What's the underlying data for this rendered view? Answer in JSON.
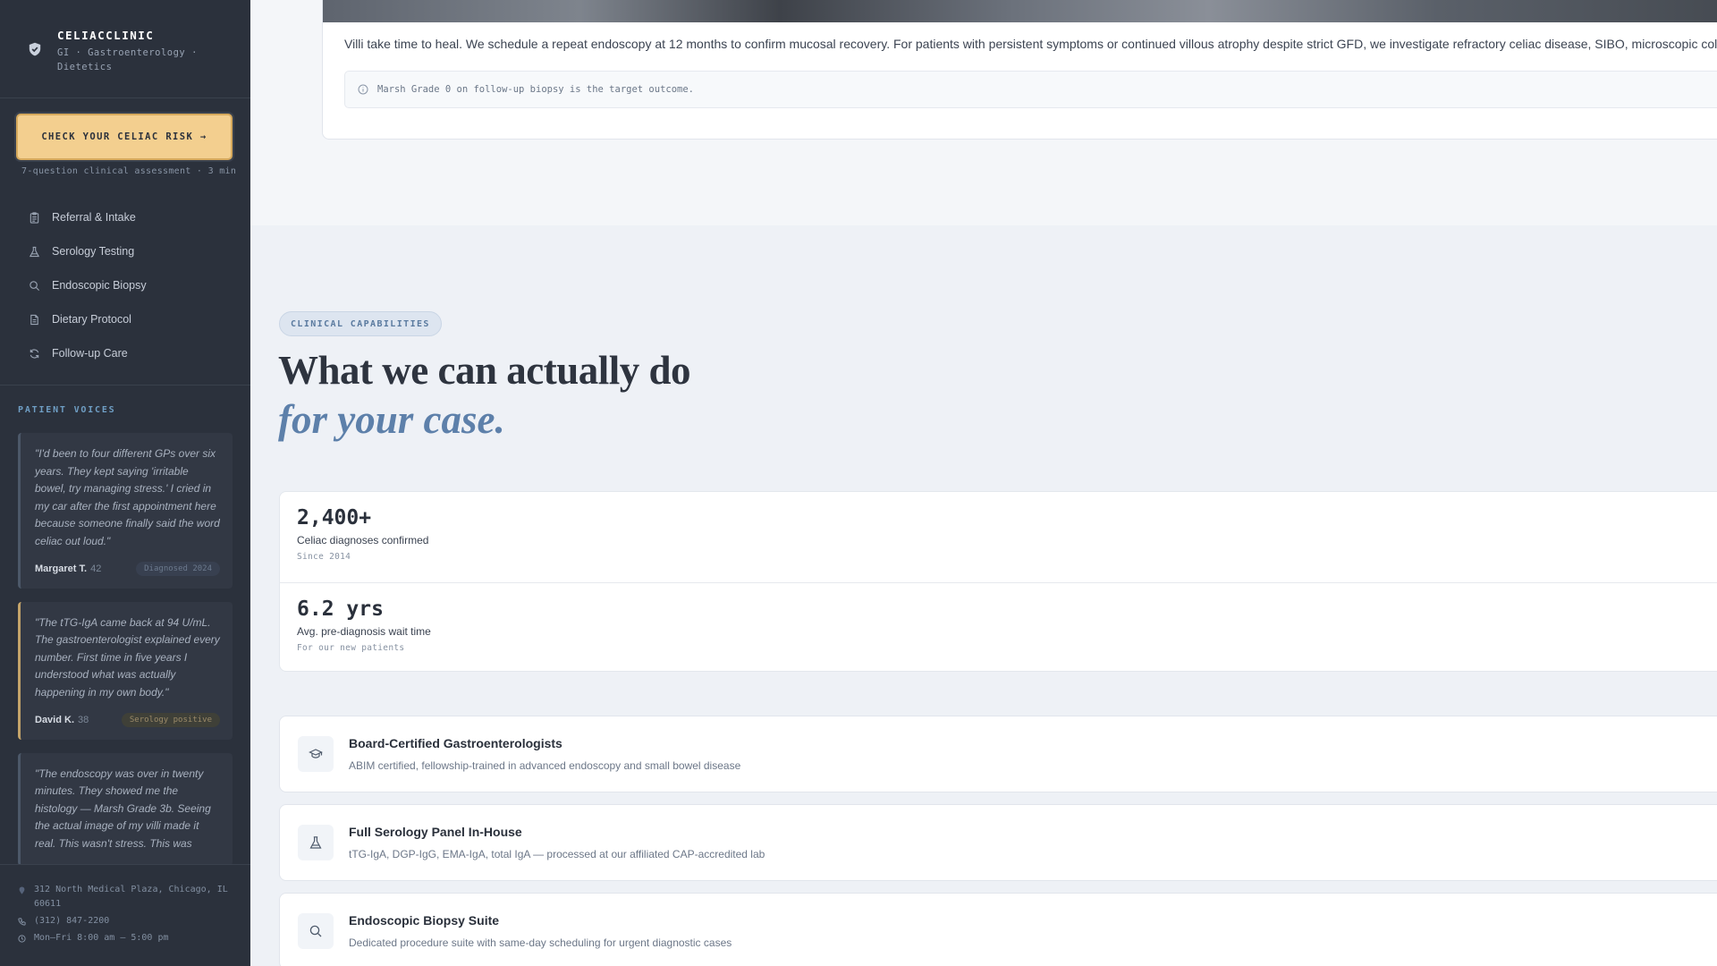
{
  "brand": {
    "name": "CELIACCLINIC",
    "subtitle": "GI · Gastroenterology · Dietetics"
  },
  "cta": {
    "label": "CHECK YOUR CELIAC RISK →",
    "note": "7-question clinical assessment · 3 min"
  },
  "nav": {
    "items": [
      {
        "label": "Referral & Intake",
        "icon": "clipboard-icon"
      },
      {
        "label": "Serology Testing",
        "icon": "flask-icon"
      },
      {
        "label": "Endoscopic Biopsy",
        "icon": "search-icon"
      },
      {
        "label": "Dietary Protocol",
        "icon": "document-icon"
      },
      {
        "label": "Follow-up Care",
        "icon": "refresh-icon"
      }
    ]
  },
  "voices": {
    "title": "PATIENT VOICES",
    "items": [
      {
        "quote": "\"I'd been to four different GPs over six years. They kept saying 'irritable bowel, try managing stress.' I cried in my car after the first appointment here because someone finally said the word celiac out loud.\"",
        "name": "Margaret T.",
        "age": "42",
        "badge": "Diagnosed 2024"
      },
      {
        "quote": "\"The tTG-IgA came back at 94 U/mL. The gastroenterologist explained every number. First time in five years I understood what was actually happening in my own body.\"",
        "name": "David K.",
        "age": "38",
        "badge": "Serology positive"
      },
      {
        "quote": "\"The endoscopy was over in twenty minutes. They showed me the histology — Marsh Grade 3b. Seeing the actual image of my villi made it real. This wasn't stress. This was",
        "name": "",
        "age": "",
        "badge": ""
      }
    ]
  },
  "footer": {
    "address": "312 North Medical Plaza, Chicago, IL 60611",
    "phone": "(312) 847-2200",
    "hours": "Mon–Fri 8:00 am – 5:00 pm"
  },
  "followup": {
    "text": "Villi take time to heal. We schedule a repeat endoscopy at 12 months to confirm mucosal recovery. For patients with persistent symptoms or continued villous atrophy despite strict GFD, we investigate refractory celiac disease, SIBO, microscopic col",
    "note": "Marsh Grade 0 on follow-up biopsy is the target outcome."
  },
  "capabilities": {
    "eyebrow": "CLINICAL CAPABILITIES",
    "headline": "What we can actually do",
    "headline_em": "for your case.",
    "stats": [
      {
        "value": "2,400+",
        "label": "Celiac diagnoses confirmed",
        "sub": "Since 2014"
      },
      {
        "value": "6.2 yrs",
        "label": "Avg. pre-diagnosis wait time",
        "sub": "For our new patients"
      }
    ],
    "items": [
      {
        "title": "Board-Certified Gastroenterologists",
        "desc": "ABIM certified, fellowship-trained in advanced endoscopy and small bowel disease",
        "icon": "graduation-cap-icon"
      },
      {
        "title": "Full Serology Panel In-House",
        "desc": "tTG-IgA, DGP-IgG, EMA-IgA, total IgA — processed at our affiliated CAP-accredited lab",
        "icon": "flask-icon"
      },
      {
        "title": "Endoscopic Biopsy Suite",
        "desc": "Dedicated procedure suite with same-day scheduling for urgent diagnostic cases",
        "icon": "search-icon"
      }
    ]
  },
  "colors": {
    "sidebar": "#2b313c",
    "cta": "#f3cf8f",
    "accent": "#5d80aa",
    "background": "#eef1f6"
  }
}
